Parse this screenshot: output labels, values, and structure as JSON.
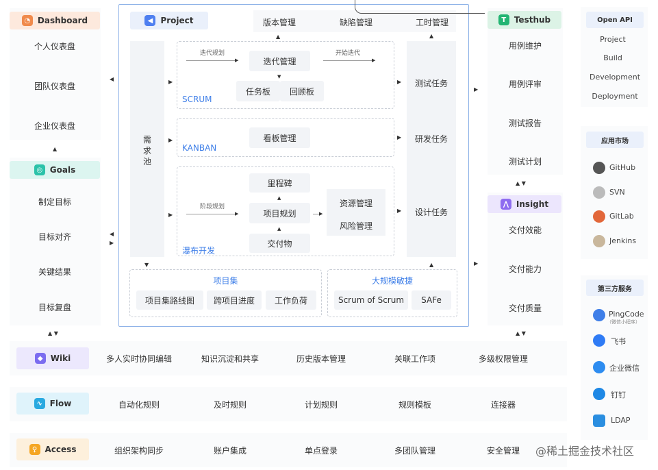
{
  "dashboard": {
    "title": "Dashboard",
    "items": [
      "个人仪表盘",
      "团队仪表盘",
      "企业仪表盘"
    ]
  },
  "goals": {
    "title": "Goals",
    "items": [
      "制定目标",
      "目标对齐",
      "关键结果",
      "目标复盘"
    ]
  },
  "project": {
    "title": "Project",
    "top": [
      "版本管理",
      "缺陷管理",
      "工时管理"
    ],
    "pool": "需求池",
    "scrum": {
      "label": "SCRUM",
      "plan": "迭代规划",
      "core": "迭代管理",
      "start": "开始迭代",
      "tasks": "任务板",
      "retro": "回顾板"
    },
    "kanban": {
      "label": "KANBAN",
      "core": "看板管理"
    },
    "waterfall": {
      "label": "瀑布开发",
      "plan": "阶段规划",
      "milestone": "里程碑",
      "core": "项目规划",
      "deliverable": "交付物",
      "resource": "资源管理",
      "risk": "风险管理"
    },
    "right": [
      "测试任务",
      "研发任务",
      "设计任务"
    ],
    "portfolio": {
      "label": "项目集",
      "items": [
        "项目集路线图",
        "跨项目进度",
        "工作负荷"
      ]
    },
    "agile": {
      "label": "大规模敏捷",
      "items": [
        "Scrum of Scrum",
        "SAFe"
      ]
    }
  },
  "testhub": {
    "title": "Testhub",
    "items": [
      "用例维护",
      "用例评审",
      "测试报告",
      "测试计划"
    ]
  },
  "insight": {
    "title": "Insight",
    "items": [
      "交付效能",
      "交付能力",
      "交付质量"
    ]
  },
  "openapi": {
    "title": "Open API",
    "items": [
      "Project",
      "Build",
      "Development",
      "Deployment"
    ]
  },
  "market": {
    "title": "应用市场",
    "items": [
      "GitHub",
      "SVN",
      "GitLab",
      "Jenkins"
    ]
  },
  "thirdparty": {
    "title": "第三方服务",
    "items": [
      "PingCode",
      "飞书",
      "企业微信",
      "钉钉",
      "LDAP"
    ],
    "pingcode_sub": "（微信小程序）"
  },
  "wiki": {
    "title": "Wiki",
    "items": [
      "多人实时协同编辑",
      "知识沉淀和共享",
      "历史版本管理",
      "关联工作项",
      "多级权限管理"
    ]
  },
  "flow": {
    "title": "Flow",
    "items": [
      "自动化规则",
      "及时规则",
      "计划规则",
      "规则模板",
      "连接器"
    ]
  },
  "access": {
    "title": "Access",
    "items": [
      "组织架构同步",
      "账户集成",
      "单点登录",
      "多团队管理",
      "安全管理"
    ]
  },
  "watermark": "@稀土掘金技术社区",
  "colors": {
    "dashboard": "#f08a4b",
    "goals": "#2cc2a9",
    "project": "#4e7ff0",
    "testhub": "#22b573",
    "insight": "#8e6cf0",
    "wiki": "#7b6cf0",
    "flow": "#29a9e0",
    "access": "#f5a623",
    "blue_text": "#3f7fe8",
    "frame": "#8fb3e8"
  }
}
